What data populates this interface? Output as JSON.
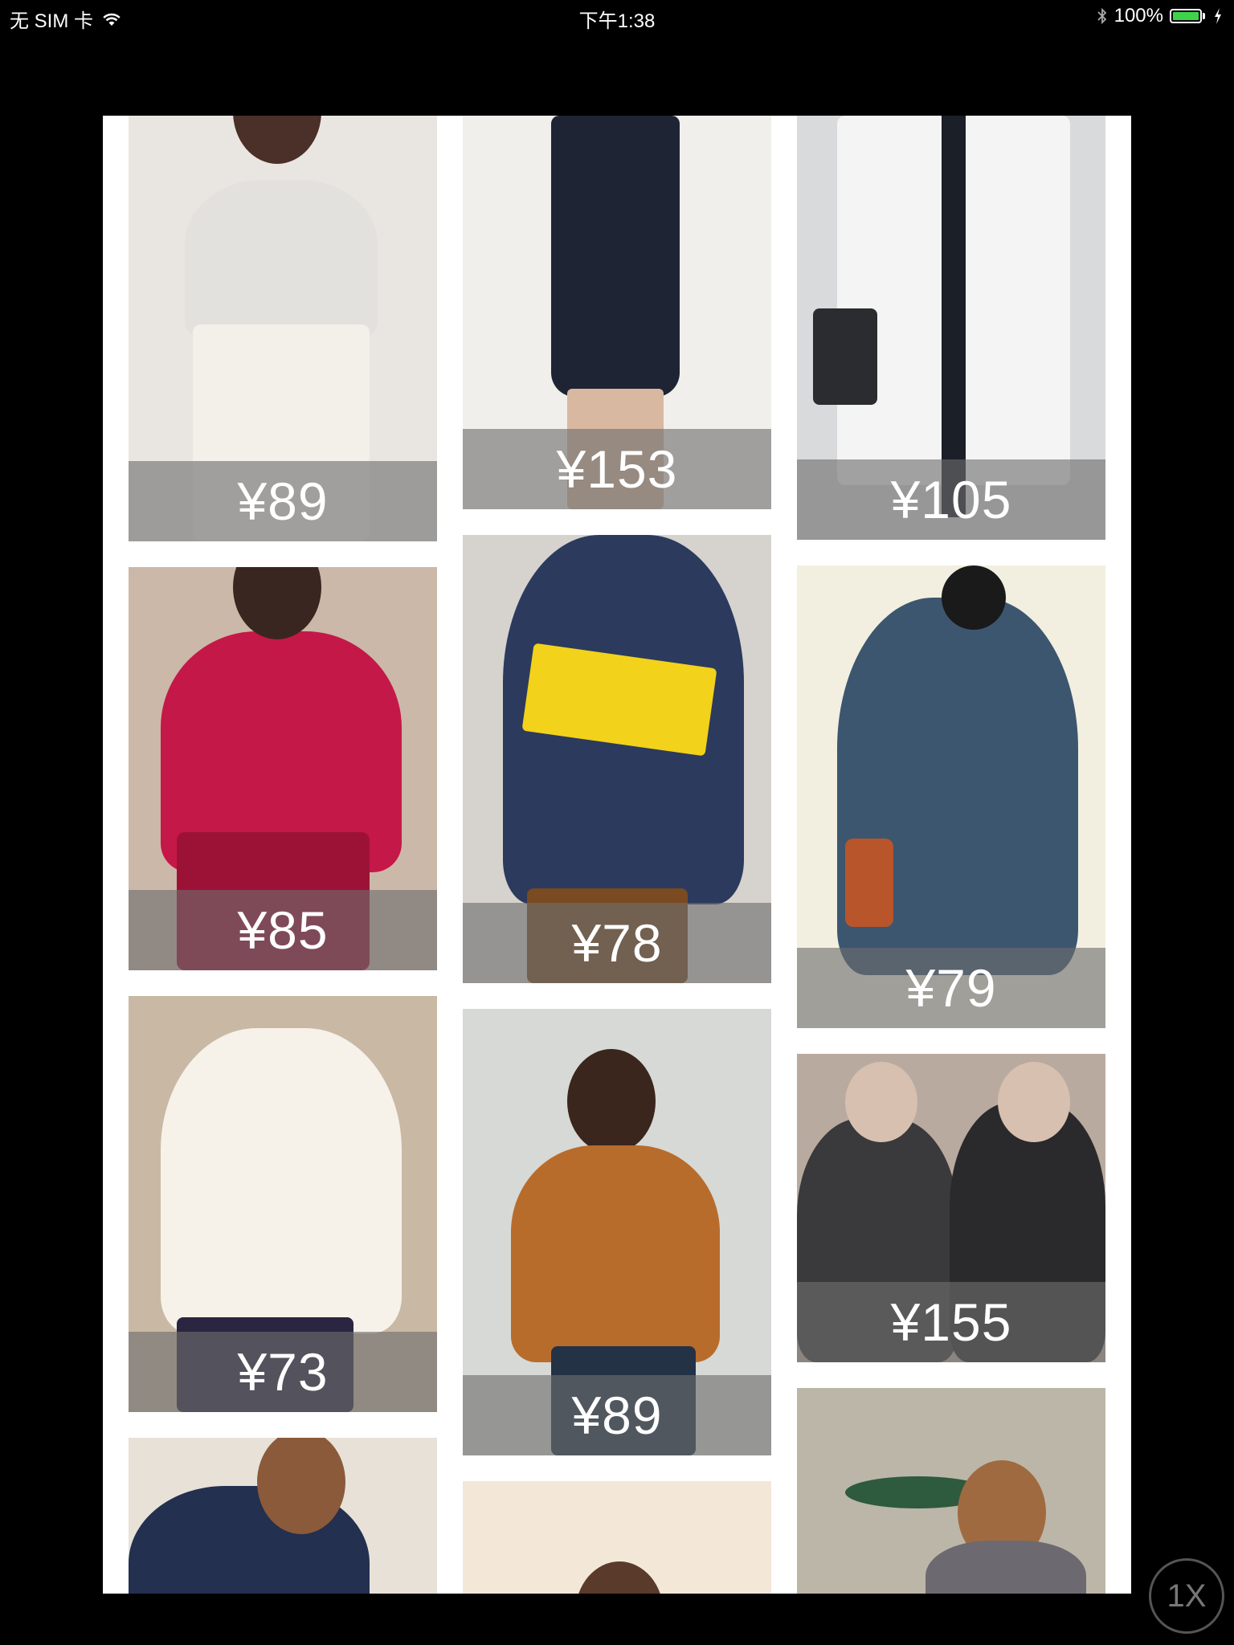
{
  "status_bar": {
    "carrier": "无 SIM 卡",
    "time": "下午1:38",
    "battery": "100%",
    "icons": [
      "wifi-icon",
      "bluetooth-icon",
      "battery-icon",
      "charging-icon"
    ]
  },
  "products": [
    {
      "price": "¥89",
      "colors": {
        "bg": "#e9e6e1",
        "top": "#e3e1de",
        "bottom": "#f3efe9"
      }
    },
    {
      "price": "¥85",
      "colors": {
        "bg": "#cbb8a8",
        "top": "#c41848",
        "bottom": "#9c1236"
      }
    },
    {
      "price": "¥73",
      "colors": {
        "bg": "#c9b9a4",
        "top": "#f6f2ea",
        "bottom": "#2a2540"
      }
    },
    {
      "price": "",
      "colors": {
        "bg": "#e8e1d8",
        "top": "#23304f",
        "bottom": "#f2f2f2"
      }
    },
    {
      "price": "¥153",
      "colors": {
        "bg": "#f1efec",
        "top": "#1e2433",
        "bottom": "#d8b8a0"
      }
    },
    {
      "price": "¥78",
      "colors": {
        "bg": "#d6d2cd",
        "top": "#2c3a5e",
        "bottom": "#7a4a20"
      }
    },
    {
      "price": "¥89",
      "colors": {
        "bg": "#d7d9d6",
        "top": "#b86c2c",
        "bottom": "#243246"
      }
    },
    {
      "price": "",
      "colors": {
        "bg": "#f3e8d8",
        "top": "#e5c9ac",
        "bottom": "#f6eadc"
      }
    },
    {
      "price": "¥105",
      "colors": {
        "bg": "#d9dadc",
        "top": "#f4f4f4",
        "bottom": "#1b1f27"
      }
    },
    {
      "price": "¥79",
      "colors": {
        "bg": "#f2efe0",
        "top": "#3c5670",
        "bottom": "#cfc6b6"
      }
    },
    {
      "price": "¥155",
      "colors": {
        "bg": "#b9aaa0",
        "top": "#3a3a3d",
        "bottom": "#2a2a2c"
      }
    },
    {
      "price": "",
      "colors": {
        "bg": "#bcb6a8",
        "top": "#6c6a70",
        "bottom": "#a08468"
      }
    }
  ],
  "zoom_label": "1X"
}
